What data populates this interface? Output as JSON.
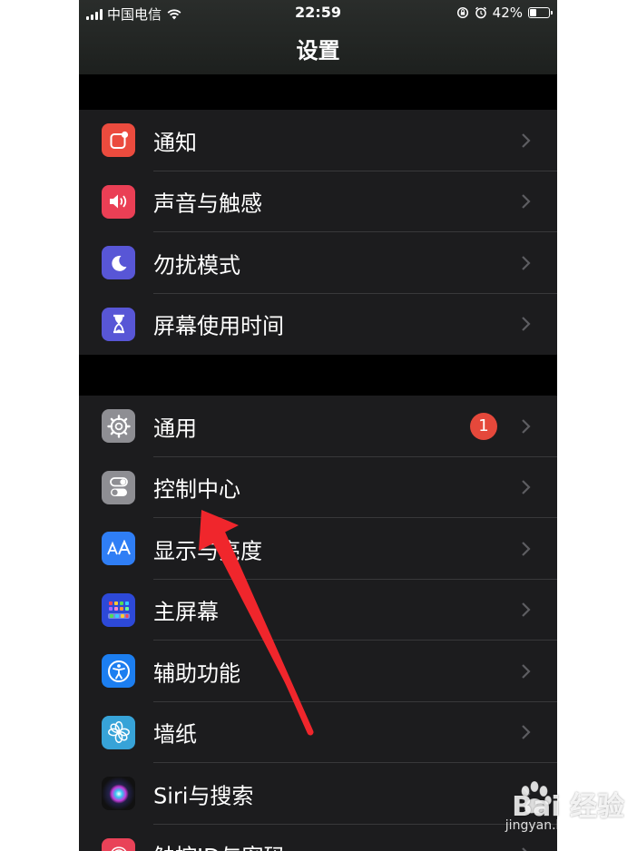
{
  "status_bar": {
    "carrier": "中国电信",
    "time": "22:59",
    "battery_percent": "42%",
    "battery_level": 0.42
  },
  "header": {
    "title": "设置"
  },
  "groups": [
    {
      "items": [
        {
          "label": "通知",
          "icon": "notification-icon",
          "color": "#eb4b3e"
        },
        {
          "label": "声音与触感",
          "icon": "speaker-icon",
          "color": "#ea3f55"
        },
        {
          "label": "勿扰模式",
          "icon": "moon-icon",
          "color": "#5856d6"
        },
        {
          "label": "屏幕使用时间",
          "icon": "hourglass-icon",
          "color": "#5856d6"
        }
      ]
    },
    {
      "items": [
        {
          "label": "通用",
          "icon": "gear-icon",
          "color": "#8e8e93",
          "badge": "1"
        },
        {
          "label": "控制中心",
          "icon": "toggle-icon",
          "color": "#8e8e93"
        },
        {
          "label": "显示与亮度",
          "icon": "display-aa-icon",
          "color": "#2f7ef5"
        },
        {
          "label": "主屏幕",
          "icon": "home-grid-icon",
          "color": "#2d49d8"
        },
        {
          "label": "辅助功能",
          "icon": "accessibility-icon",
          "color": "#1c7ef0"
        },
        {
          "label": "墙纸",
          "icon": "flower-icon",
          "color": "#37a3d8"
        },
        {
          "label": "Siri与搜索",
          "icon": "siri-icon",
          "color": "#222"
        },
        {
          "label": "触控ID与密码",
          "icon": "fingerprint-icon",
          "color": "#e94258"
        }
      ]
    }
  ],
  "watermark": {
    "logo": "Bai 经验",
    "url": "jingyan.baidu.com"
  }
}
